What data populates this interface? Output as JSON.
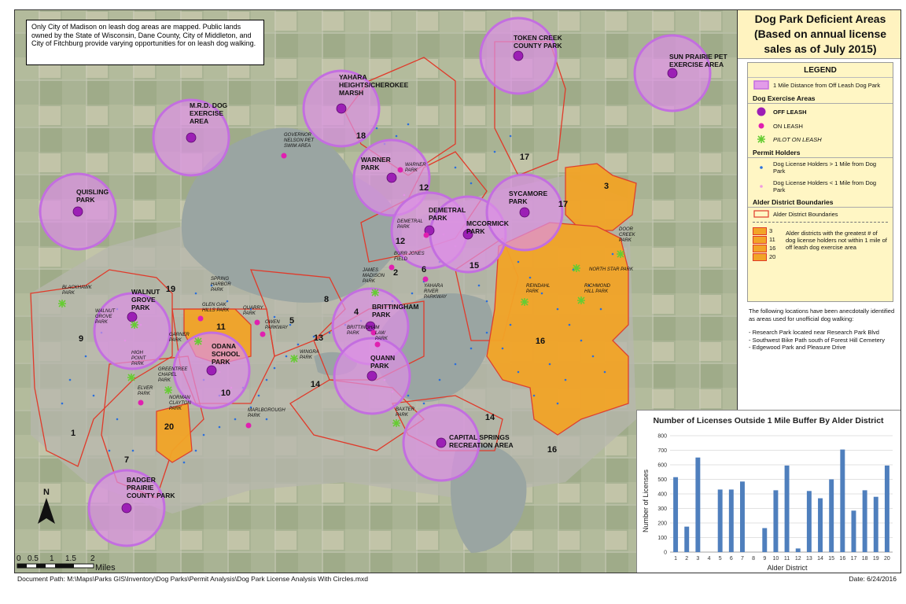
{
  "note_box": {
    "text": "Only City of Madison on leash dog areas are mapped. Public lands owned by the State of Wisconsin, Dane County, City of Middleton, and City of Fitchburg provide varying opportunities for on leash dog walking."
  },
  "title": {
    "line1": "Dog Park Deficient Areas",
    "line2": "(Based on annual license",
    "line3": "sales as of July 2015)"
  },
  "legend": {
    "heading": "LEGEND",
    "buffer_label": "1 Mile Distance from Off Leash Dog Park",
    "exercise_heading": "Dog Exercise Areas",
    "off_leash": "OFF LEASH",
    "on_leash": "ON LEASH",
    "pilot": "PILOT ON LEASH",
    "permit_heading": "Permit Holders",
    "far_holders": "Dog License Holders > 1 Mile from Dog Park",
    "near_holders": "Dog License Holders < 1 Mile from Dog Park",
    "alder_heading": "Alder District Boundaries",
    "alder_label": "Alder District Boundaries",
    "deficient_label": "Alder districts with the greatest # of dog license holders not within 1 mile of off leash dog exercise area",
    "deficient_districts": [
      "3",
      "11",
      "16",
      "20"
    ],
    "colors": {
      "buffer": "#e39be9",
      "off_leash": "#9c1fb5",
      "on_leash": "#e020b0",
      "pilot": "#66cc33",
      "far": "#2b6fdc",
      "near": "#f09ae0",
      "boundary": "#e03a2a",
      "deficient": "#f2a427"
    }
  },
  "notes": {
    "intro": "The following locations have been anecdotally identified as areas used for unofficial dog walking:",
    "items": [
      "- Research Park located near Research Park Blvd",
      "- Southwest Bike Path south of Forest Hill Cemetery",
      "- Edgewood Park and Pleasure Drive"
    ]
  },
  "map_labels": {
    "parks": [
      {
        "id": "token-creek",
        "lines": [
          "TOKEN CREEK",
          "COUNTY PARK"
        ]
      },
      {
        "id": "sun-prairie",
        "lines": [
          "SUN PRAIRIE PET",
          "EXERCISE AREA"
        ]
      },
      {
        "id": "yahara-heights",
        "lines": [
          "YAHARA",
          "HEIGHTS/CHEROKEE",
          "MARSH"
        ]
      },
      {
        "id": "mrd",
        "lines": [
          "M.R.D. DOG",
          "EXERCISE",
          "AREA"
        ]
      },
      {
        "id": "quisling",
        "lines": [
          "QUISLING",
          "PARK"
        ]
      },
      {
        "id": "warner",
        "lines": [
          "WARNER",
          "PARK"
        ]
      },
      {
        "id": "demetral",
        "lines": [
          "DEMETRAL",
          "PARK"
        ]
      },
      {
        "id": "mccormick",
        "lines": [
          "MCCORMICK",
          "PARK"
        ]
      },
      {
        "id": "sycamore",
        "lines": [
          "SYCAMORE",
          "PARK"
        ]
      },
      {
        "id": "walnut-grove",
        "lines": [
          "WALNUT",
          "GROVE",
          "PARK"
        ]
      },
      {
        "id": "odana",
        "lines": [
          "ODANA",
          "SCHOOL",
          "PARK"
        ]
      },
      {
        "id": "brittingham",
        "lines": [
          "BRITTINGHAM",
          "PARK"
        ]
      },
      {
        "id": "quann",
        "lines": [
          "QUANN",
          "PARK"
        ]
      },
      {
        "id": "capital-springs",
        "lines": [
          "CAPITAL SPRINGS",
          "RECREATION AREA"
        ]
      },
      {
        "id": "badger-prairie",
        "lines": [
          "BADGER",
          "PRAIRIE",
          "COUNTY PARK"
        ]
      }
    ],
    "small": [
      {
        "id": "governor-nelson",
        "lines": [
          "GOVERNOR",
          "NELSON PET",
          "SWIM AREA"
        ]
      },
      {
        "id": "warner-on",
        "lines": [
          "WARNER",
          "PARK"
        ]
      },
      {
        "id": "demetral-on",
        "lines": [
          "DEMETRAL",
          "PARK"
        ]
      },
      {
        "id": "burr-jones",
        "lines": [
          "BURR JONES",
          "FIELD"
        ]
      },
      {
        "id": "james-madison",
        "lines": [
          "JAMES",
          "MADISON",
          "PARK"
        ]
      },
      {
        "id": "yahara-river",
        "lines": [
          "YAHARA",
          "RIVER",
          "PARKWAY"
        ]
      },
      {
        "id": "spring-harbor",
        "lines": [
          "SPRING",
          "HARBOR",
          "PARK"
        ]
      },
      {
        "id": "glen-oak",
        "lines": [
          "GLEN OAK",
          "HILLS PARK"
        ]
      },
      {
        "id": "quarry",
        "lines": [
          "QUARRY",
          "PARK"
        ]
      },
      {
        "id": "owen",
        "lines": [
          "OWEN",
          "PARKWAY"
        ]
      },
      {
        "id": "blackhawk",
        "lines": [
          "BLACKHAWK",
          "PARK"
        ]
      },
      {
        "id": "walnut-grove-pilot",
        "lines": [
          "WALNUT",
          "GROVE",
          "PARK"
        ]
      },
      {
        "id": "garner",
        "lines": [
          "GARNER",
          "PARK"
        ]
      },
      {
        "id": "high-point",
        "lines": [
          "HIGH",
          "POINT",
          "PARK"
        ]
      },
      {
        "id": "greentree",
        "lines": [
          "GREENTREE",
          "CHAPEL",
          "PARK"
        ]
      },
      {
        "id": "elver",
        "lines": [
          "ELVER",
          "PARK"
        ]
      },
      {
        "id": "norman-clayton",
        "lines": [
          "NORMAN",
          "CLAYTON",
          "PARK"
        ]
      },
      {
        "id": "wingra",
        "lines": [
          "WINGRA",
          "PARK"
        ]
      },
      {
        "id": "brittingham-on",
        "lines": [
          "BRITTINGHAM",
          "PARK"
        ]
      },
      {
        "id": "law",
        "lines": [
          "LAW",
          "PARK"
        ]
      },
      {
        "id": "marlborough",
        "lines": [
          "MARLBOROUGH",
          "PARK"
        ]
      },
      {
        "id": "baxter",
        "lines": [
          "BAXTER",
          "PARK"
        ]
      },
      {
        "id": "door-creek",
        "lines": [
          "DOOR",
          "CREEK",
          "PARK"
        ]
      },
      {
        "id": "north-star",
        "lines": [
          "NORTH STAR PARK"
        ]
      },
      {
        "id": "richmond-hill",
        "lines": [
          "RICHMOND",
          "HILL PARK"
        ]
      },
      {
        "id": "reindahl",
        "lines": [
          "REINDAHL",
          "PARK"
        ]
      }
    ],
    "districts": [
      "18",
      "17",
      "12",
      "3",
      "17",
      "12",
      "6",
      "2",
      "15",
      "8",
      "4",
      "19",
      "11",
      "5",
      "13",
      "9",
      "10",
      "14",
      "20",
      "1",
      "7",
      "16",
      "14",
      "16"
    ]
  },
  "north_arrow": {
    "label": "N"
  },
  "scale": {
    "ticks": [
      "0",
      "0.5",
      "1",
      "1.5",
      "2"
    ],
    "unit": "Miles"
  },
  "chart_data": {
    "type": "bar",
    "title": "Number of Licenses Outside 1 Mile Buffer By Alder District",
    "xlabel": "Alder District",
    "ylabel": "Number of Licenses",
    "categories": [
      "1",
      "2",
      "3",
      "4",
      "5",
      "6",
      "7",
      "8",
      "9",
      "10",
      "11",
      "12",
      "13",
      "14",
      "15",
      "16",
      "17",
      "18",
      "19",
      "20"
    ],
    "values": [
      515,
      175,
      650,
      0,
      430,
      430,
      485,
      0,
      165,
      425,
      595,
      25,
      420,
      370,
      500,
      705,
      285,
      425,
      380,
      595
    ],
    "ylim": [
      0,
      800
    ],
    "yticks": [
      "0",
      "100",
      "200",
      "300",
      "400",
      "500",
      "600",
      "700",
      "800"
    ],
    "grid": true,
    "color": "#4f7fbd"
  },
  "footer": {
    "doc_path": "Document Path: M:\\Maps\\Parks GIS\\Inventory\\Dog Parks\\Permit Analysis\\Dog Park License Analysis With Circles.mxd",
    "date": "Date: 6/24/2016"
  }
}
